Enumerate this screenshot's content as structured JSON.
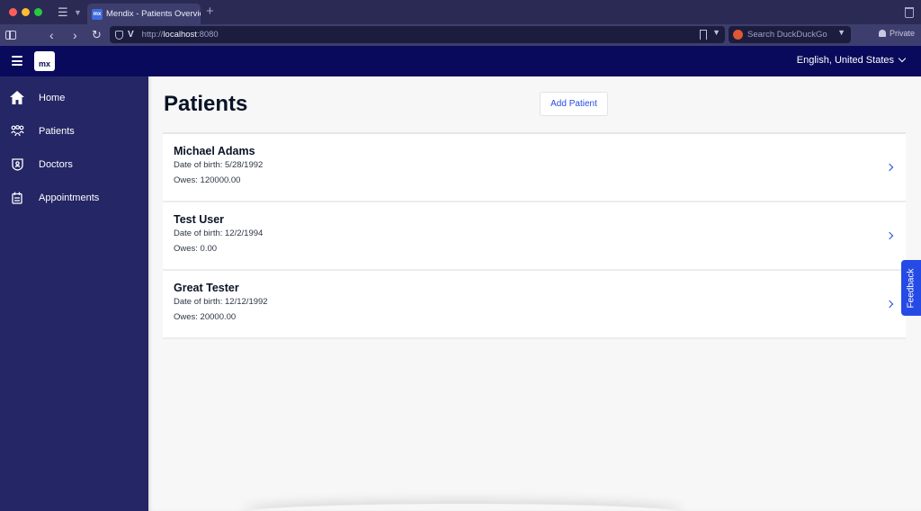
{
  "browser": {
    "tab_title": "Mendix - Patients Overview",
    "tab_favicon": "mx",
    "url_prefix": "http://",
    "url_host": "localhost",
    "url_port": ":8080",
    "search_placeholder": "Search DuckDuckGo",
    "private_label": "Private"
  },
  "header": {
    "logo_text": "mx",
    "language": "English, United States"
  },
  "sidebar": {
    "items": [
      {
        "label": "Home",
        "icon": "home-icon"
      },
      {
        "label": "Patients",
        "icon": "patients-icon"
      },
      {
        "label": "Doctors",
        "icon": "doctor-badge-icon"
      },
      {
        "label": "Appointments",
        "icon": "calendar-icon"
      }
    ]
  },
  "main": {
    "title": "Patients",
    "add_button": "Add Patient",
    "patients": [
      {
        "name": "Michael Adams",
        "dob": "Date of birth: 5/28/1992",
        "owes": "Owes: 120000.00"
      },
      {
        "name": "Test User",
        "dob": "Date of birth: 12/2/1994",
        "owes": "Owes: 0.00"
      },
      {
        "name": "Great Tester",
        "dob": "Date of birth: 12/12/1992",
        "owes": "Owes: 20000.00"
      }
    ]
  },
  "feedback_label": "Feedback"
}
